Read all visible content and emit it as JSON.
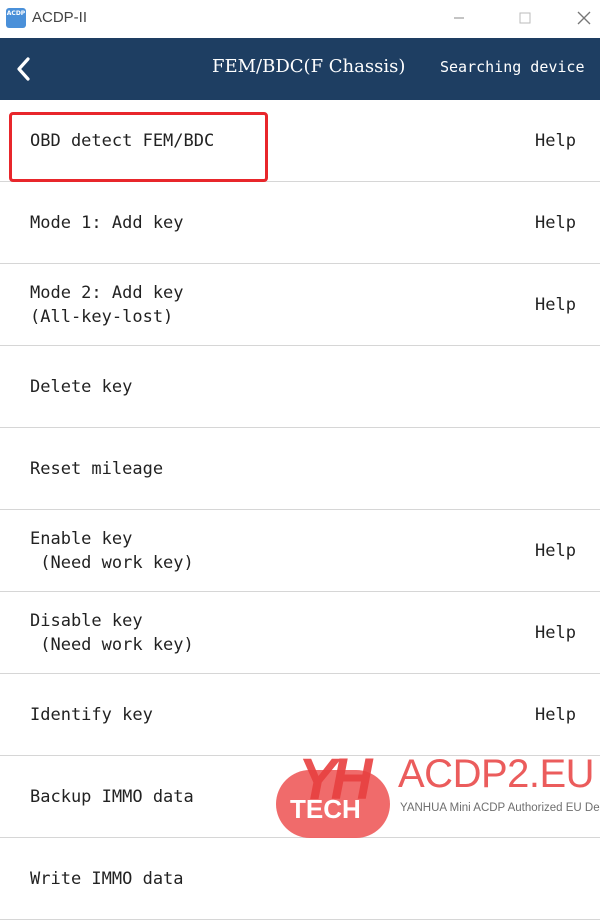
{
  "window": {
    "title": "ACDP-II",
    "icon_text": "ACDP",
    "controls": [
      "minimize-icon",
      "maximize-icon",
      "close-icon"
    ]
  },
  "header": {
    "title": "FEM/BDC(F Chassis)",
    "status": "Searching device",
    "background": "#1e3e62",
    "back_icon": "chevron-left-icon"
  },
  "menu": {
    "items": [
      {
        "label": "OBD detect FEM/BDC",
        "help": "Help"
      },
      {
        "label": "Mode 1: Add key",
        "help": "Help"
      },
      {
        "label": "Mode 2: Add key\n(All-key-lost)",
        "help": "Help"
      },
      {
        "label": "Delete key",
        "help": ""
      },
      {
        "label": "Reset mileage",
        "help": ""
      },
      {
        "label": "Enable key\n (Need work key)",
        "help": "Help"
      },
      {
        "label": "Disable key\n (Need work key)",
        "help": "Help"
      },
      {
        "label": "Identify key",
        "help": "Help"
      },
      {
        "label": "Backup IMMO data",
        "help": ""
      },
      {
        "label": "Write IMMO data",
        "help": ""
      }
    ],
    "highlight_color": "#e8262b"
  },
  "watermark": {
    "logo_letters": "YH",
    "logo_tech": "TECH",
    "brand": "ACDP2.EU",
    "subtitle": "YANHUA Mini ACDP Authorized EU Dealer",
    "color": "#e84040"
  }
}
